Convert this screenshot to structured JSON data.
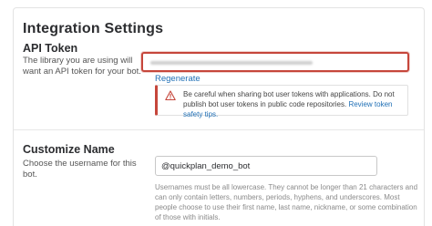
{
  "page": {
    "title": "Integration Settings"
  },
  "api_token": {
    "label": "API Token",
    "description": "The library you are using will want an API token for your bot.",
    "regenerate_label": "Regenerate",
    "warning_text": "Be careful when sharing bot user tokens with applications. Do not publish bot user tokens in public code repositories.",
    "warning_link": "Review token safety tips.",
    "accent_color": "#c6463b"
  },
  "customize_name": {
    "label": "Customize Name",
    "description": "Choose the username for this bot.",
    "input_value": "@quickplan_demo_bot",
    "help_text": "Usernames must be all lowercase. They cannot be longer than 21 characters and can only contain letters, numbers, periods, hyphens, and underscores. Most people choose to use their first name, last name, nickname, or some combination of those with initials."
  },
  "colors": {
    "link": "#1f6fb5",
    "text": "#2c2d30"
  }
}
